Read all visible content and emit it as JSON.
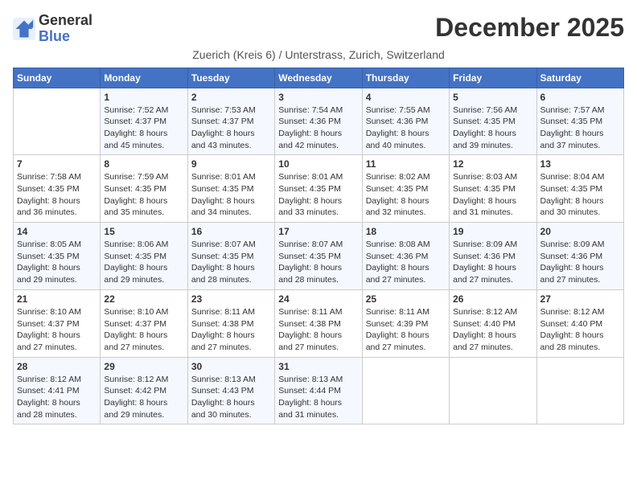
{
  "header": {
    "logo_general": "General",
    "logo_blue": "Blue",
    "title": "December 2025",
    "subtitle": "Zuerich (Kreis 6) / Unterstrass, Zurich, Switzerland"
  },
  "calendar": {
    "days_of_week": [
      "Sunday",
      "Monday",
      "Tuesday",
      "Wednesday",
      "Thursday",
      "Friday",
      "Saturday"
    ],
    "weeks": [
      [
        {
          "day": "",
          "info": ""
        },
        {
          "day": "1",
          "info": "Sunrise: 7:52 AM\nSunset: 4:37 PM\nDaylight: 8 hours\nand 45 minutes."
        },
        {
          "day": "2",
          "info": "Sunrise: 7:53 AM\nSunset: 4:37 PM\nDaylight: 8 hours\nand 43 minutes."
        },
        {
          "day": "3",
          "info": "Sunrise: 7:54 AM\nSunset: 4:36 PM\nDaylight: 8 hours\nand 42 minutes."
        },
        {
          "day": "4",
          "info": "Sunrise: 7:55 AM\nSunset: 4:36 PM\nDaylight: 8 hours\nand 40 minutes."
        },
        {
          "day": "5",
          "info": "Sunrise: 7:56 AM\nSunset: 4:35 PM\nDaylight: 8 hours\nand 39 minutes."
        },
        {
          "day": "6",
          "info": "Sunrise: 7:57 AM\nSunset: 4:35 PM\nDaylight: 8 hours\nand 37 minutes."
        }
      ],
      [
        {
          "day": "7",
          "info": "Sunrise: 7:58 AM\nSunset: 4:35 PM\nDaylight: 8 hours\nand 36 minutes."
        },
        {
          "day": "8",
          "info": "Sunrise: 7:59 AM\nSunset: 4:35 PM\nDaylight: 8 hours\nand 35 minutes."
        },
        {
          "day": "9",
          "info": "Sunrise: 8:01 AM\nSunset: 4:35 PM\nDaylight: 8 hours\nand 34 minutes."
        },
        {
          "day": "10",
          "info": "Sunrise: 8:01 AM\nSunset: 4:35 PM\nDaylight: 8 hours\nand 33 minutes."
        },
        {
          "day": "11",
          "info": "Sunrise: 8:02 AM\nSunset: 4:35 PM\nDaylight: 8 hours\nand 32 minutes."
        },
        {
          "day": "12",
          "info": "Sunrise: 8:03 AM\nSunset: 4:35 PM\nDaylight: 8 hours\nand 31 minutes."
        },
        {
          "day": "13",
          "info": "Sunrise: 8:04 AM\nSunset: 4:35 PM\nDaylight: 8 hours\nand 30 minutes."
        }
      ],
      [
        {
          "day": "14",
          "info": "Sunrise: 8:05 AM\nSunset: 4:35 PM\nDaylight: 8 hours\nand 29 minutes."
        },
        {
          "day": "15",
          "info": "Sunrise: 8:06 AM\nSunset: 4:35 PM\nDaylight: 8 hours\nand 29 minutes."
        },
        {
          "day": "16",
          "info": "Sunrise: 8:07 AM\nSunset: 4:35 PM\nDaylight: 8 hours\nand 28 minutes."
        },
        {
          "day": "17",
          "info": "Sunrise: 8:07 AM\nSunset: 4:35 PM\nDaylight: 8 hours\nand 28 minutes."
        },
        {
          "day": "18",
          "info": "Sunrise: 8:08 AM\nSunset: 4:36 PM\nDaylight: 8 hours\nand 27 minutes."
        },
        {
          "day": "19",
          "info": "Sunrise: 8:09 AM\nSunset: 4:36 PM\nDaylight: 8 hours\nand 27 minutes."
        },
        {
          "day": "20",
          "info": "Sunrise: 8:09 AM\nSunset: 4:36 PM\nDaylight: 8 hours\nand 27 minutes."
        }
      ],
      [
        {
          "day": "21",
          "info": "Sunrise: 8:10 AM\nSunset: 4:37 PM\nDaylight: 8 hours\nand 27 minutes."
        },
        {
          "day": "22",
          "info": "Sunrise: 8:10 AM\nSunset: 4:37 PM\nDaylight: 8 hours\nand 27 minutes."
        },
        {
          "day": "23",
          "info": "Sunrise: 8:11 AM\nSunset: 4:38 PM\nDaylight: 8 hours\nand 27 minutes."
        },
        {
          "day": "24",
          "info": "Sunrise: 8:11 AM\nSunset: 4:38 PM\nDaylight: 8 hours\nand 27 minutes."
        },
        {
          "day": "25",
          "info": "Sunrise: 8:11 AM\nSunset: 4:39 PM\nDaylight: 8 hours\nand 27 minutes."
        },
        {
          "day": "26",
          "info": "Sunrise: 8:12 AM\nSunset: 4:40 PM\nDaylight: 8 hours\nand 27 minutes."
        },
        {
          "day": "27",
          "info": "Sunrise: 8:12 AM\nSunset: 4:40 PM\nDaylight: 8 hours\nand 28 minutes."
        }
      ],
      [
        {
          "day": "28",
          "info": "Sunrise: 8:12 AM\nSunset: 4:41 PM\nDaylight: 8 hours\nand 28 minutes."
        },
        {
          "day": "29",
          "info": "Sunrise: 8:12 AM\nSunset: 4:42 PM\nDaylight: 8 hours\nand 29 minutes."
        },
        {
          "day": "30",
          "info": "Sunrise: 8:13 AM\nSunset: 4:43 PM\nDaylight: 8 hours\nand 30 minutes."
        },
        {
          "day": "31",
          "info": "Sunrise: 8:13 AM\nSunset: 4:44 PM\nDaylight: 8 hours\nand 31 minutes."
        },
        {
          "day": "",
          "info": ""
        },
        {
          "day": "",
          "info": ""
        },
        {
          "day": "",
          "info": ""
        }
      ]
    ]
  }
}
